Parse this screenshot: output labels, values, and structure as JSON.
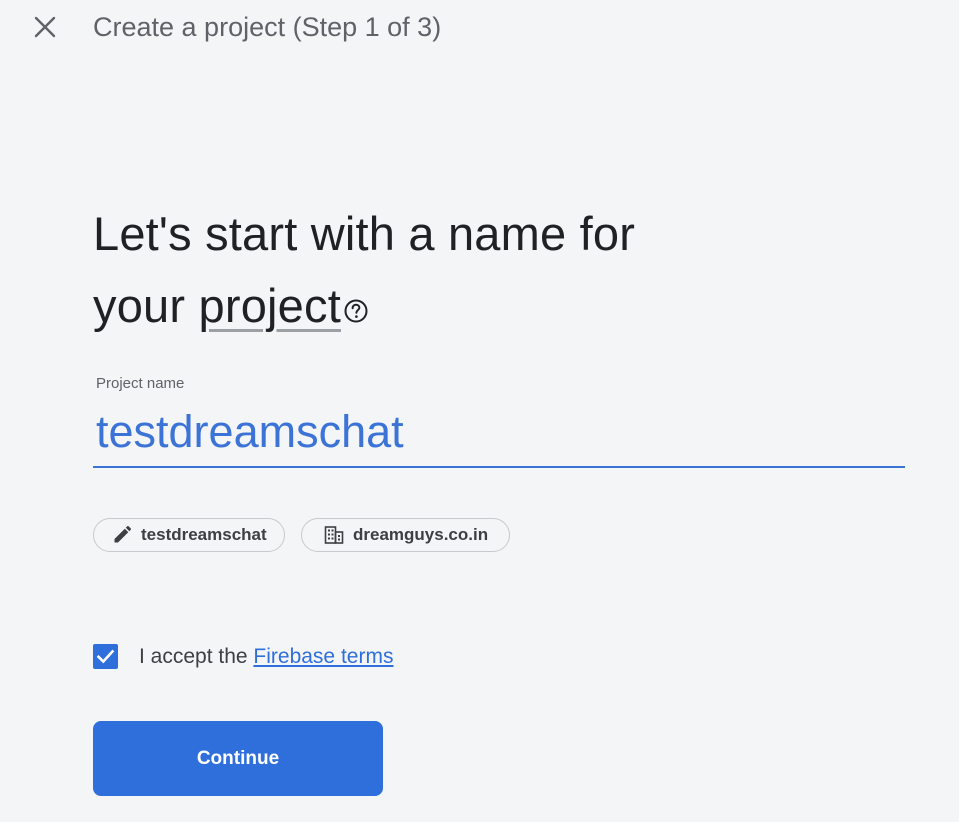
{
  "header": {
    "title": "Create a project (Step 1 of 3)",
    "close_icon": "close-icon"
  },
  "main": {
    "heading_line1": "Let's start with a name for",
    "heading_line2_prefix": "your ",
    "heading_line2_link": "project",
    "help_icon": "help-circle-icon",
    "project_name": {
      "label": "Project name",
      "value": "testdreamschat"
    },
    "chips": [
      {
        "icon": "pencil-icon",
        "label": "testdreamschat"
      },
      {
        "icon": "building-icon",
        "label": "dreamguys.co.in"
      }
    ],
    "terms": {
      "checked": true,
      "prefix": "I accept the ",
      "link": "Firebase terms"
    },
    "continue_label": "Continue"
  },
  "colors": {
    "accent": "#2f6fdc",
    "background": "#f4f5f7",
    "text_primary": "#202124",
    "text_secondary": "#5f6368"
  }
}
